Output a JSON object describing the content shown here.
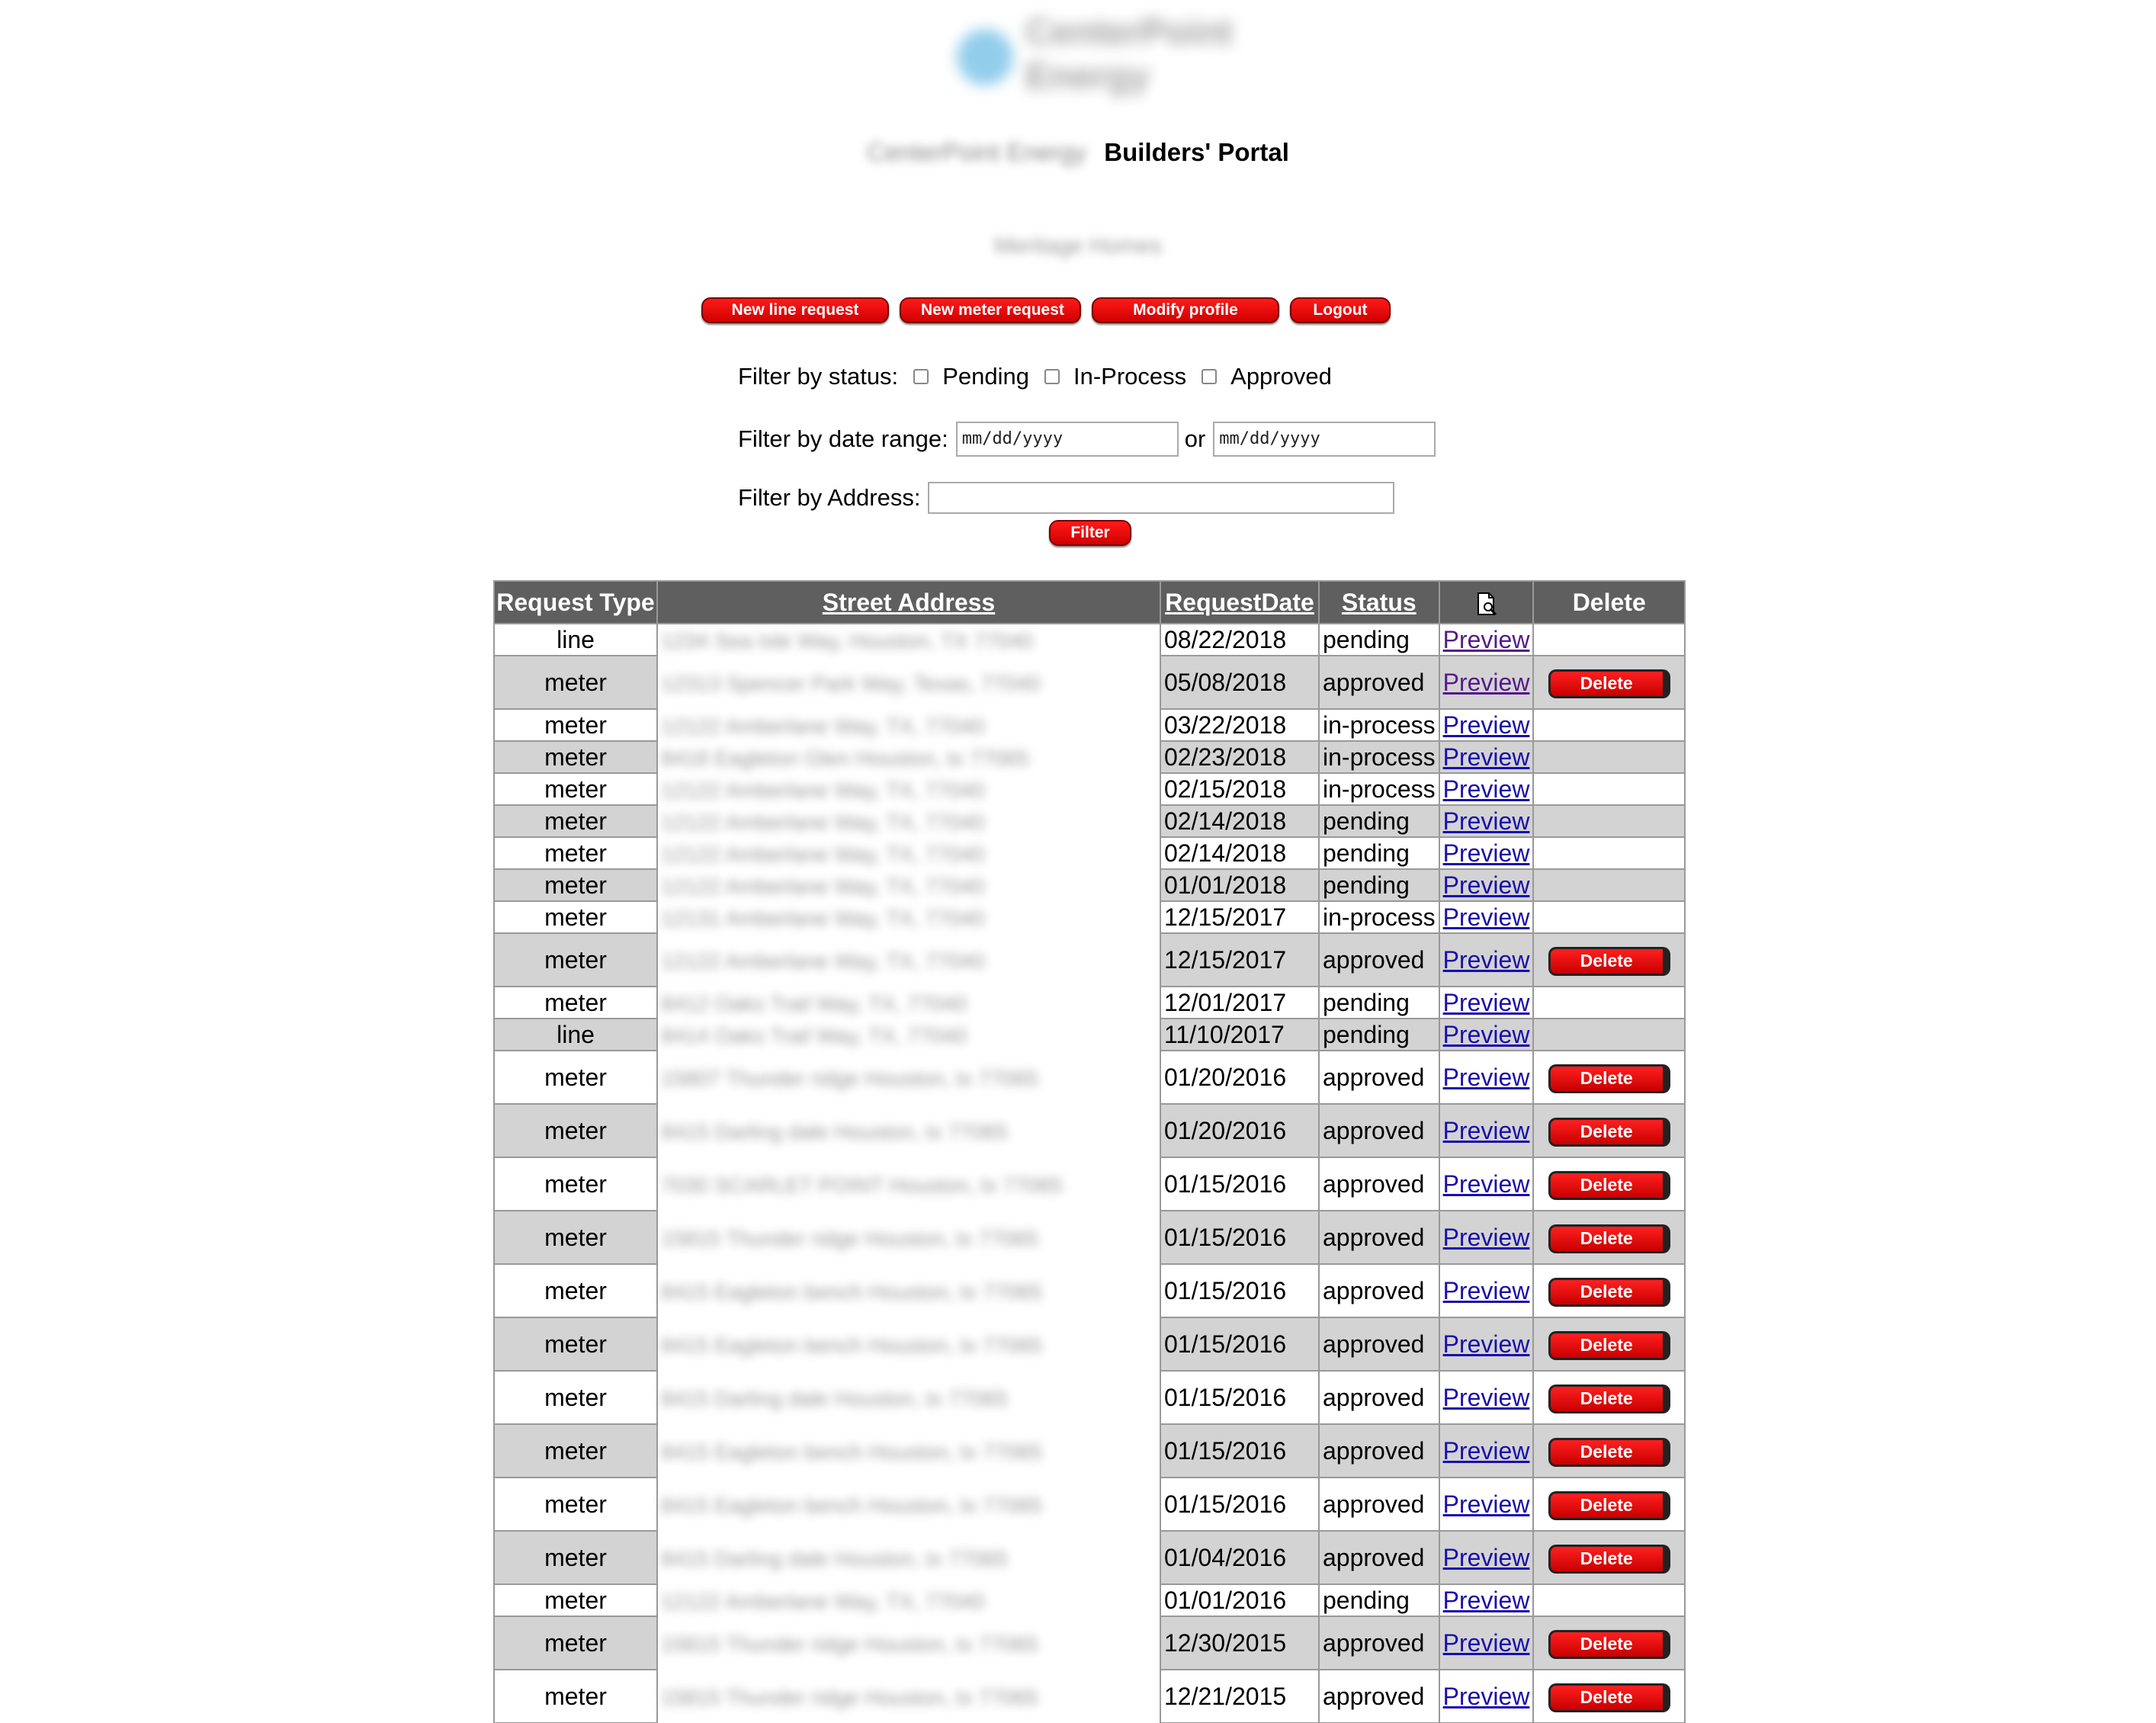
{
  "header": {
    "logo_text": "CenterPoint\nEnergy",
    "company": "CenterPoint Energy",
    "portal_title": "Builders' Portal",
    "builder_name": "Meritage Homes"
  },
  "toolbar": {
    "new_line_label": "New line request",
    "new_meter_label": "New meter request",
    "modify_profile_label": "Modify profile",
    "logout_label": "Logout"
  },
  "filters": {
    "status_label": "Filter by status:",
    "pending_label": "Pending",
    "inprocess_label": "In-Process",
    "approved_label": "Approved",
    "date_label": "Filter by date range:",
    "date_from_placeholder": "mm/dd/yyyy",
    "or_label": "or",
    "date_to_placeholder": "mm/dd/yyyy",
    "address_label": "Filter by Address:",
    "filter_button_label": "Filter"
  },
  "table": {
    "headers": {
      "type": "Request Type",
      "address": "Street Address",
      "date": "RequestDate",
      "status": "Status",
      "preview_icon": "document-preview-icon",
      "delete": "Delete"
    },
    "preview_label": "Preview",
    "delete_label": "Delete",
    "rows": [
      {
        "type": "line",
        "address": "1234 Sea Isle Way, Houston, TX 77040",
        "date": "08/22/2018",
        "status": "pending",
        "delete": false
      },
      {
        "type": "meter",
        "address": "12313 Spencer Park Way, Texas, 77040",
        "date": "05/08/2018",
        "status": "approved",
        "delete": true
      },
      {
        "type": "meter",
        "address": "12122 Amberlane Way, TX, 77040",
        "date": "03/22/2018",
        "status": "in-process",
        "delete": false
      },
      {
        "type": "meter",
        "address": "8418 Eagleton Glen Houston, tx 77065",
        "date": "02/23/2018",
        "status": "in-process",
        "delete": false
      },
      {
        "type": "meter",
        "address": "12122 Amberlane Way, TX, 77040",
        "date": "02/15/2018",
        "status": "in-process",
        "delete": false
      },
      {
        "type": "meter",
        "address": "12122 Amberlane Way, TX, 77040",
        "date": "02/14/2018",
        "status": "pending",
        "delete": false
      },
      {
        "type": "meter",
        "address": "12122 Amberlane Way, TX, 77040",
        "date": "02/14/2018",
        "status": "pending",
        "delete": false
      },
      {
        "type": "meter",
        "address": "12122 Amberlane Way, TX, 77040",
        "date": "01/01/2018",
        "status": "pending",
        "delete": false
      },
      {
        "type": "meter",
        "address": "12131 Amberlane Way, TX, 77040",
        "date": "12/15/2017",
        "status": "in-process",
        "delete": false
      },
      {
        "type": "meter",
        "address": "12122 Amberlane Way, TX, 77040",
        "date": "12/15/2017",
        "status": "approved",
        "delete": true
      },
      {
        "type": "meter",
        "address": "8412 Oaks Trail Way, TX, 77040",
        "date": "12/01/2017",
        "status": "pending",
        "delete": false
      },
      {
        "type": "line",
        "address": "8414 Oaks Trail Way, TX, 77040",
        "date": "11/10/2017",
        "status": "pending",
        "delete": false
      },
      {
        "type": "meter",
        "address": "15807 Thunder ridge Houston, tx 77065",
        "date": "01/20/2016",
        "status": "approved",
        "delete": true
      },
      {
        "type": "meter",
        "address": "8415 Darling dale Houston, tx 77065",
        "date": "01/20/2016",
        "status": "approved",
        "delete": true
      },
      {
        "type": "meter",
        "address": "7030 SCARLET POINT Houston, tx 77065",
        "date": "01/15/2016",
        "status": "approved",
        "delete": true
      },
      {
        "type": "meter",
        "address": "15815 Thunder ridge Houston, tx 77065",
        "date": "01/15/2016",
        "status": "approved",
        "delete": true
      },
      {
        "type": "meter",
        "address": "8415 Eagleton bench Houston, tx 77065",
        "date": "01/15/2016",
        "status": "approved",
        "delete": true
      },
      {
        "type": "meter",
        "address": "8415 Eagleton bench Houston, tx 77065",
        "date": "01/15/2016",
        "status": "approved",
        "delete": true
      },
      {
        "type": "meter",
        "address": "8415 Darling dale Houston, tx 77065",
        "date": "01/15/2016",
        "status": "approved",
        "delete": true
      },
      {
        "type": "meter",
        "address": "8415 Eagleton bench Houston, tx 77065",
        "date": "01/15/2016",
        "status": "approved",
        "delete": true
      },
      {
        "type": "meter",
        "address": "8415 Eagleton bench Houston, tx 77065",
        "date": "01/15/2016",
        "status": "approved",
        "delete": true
      },
      {
        "type": "meter",
        "address": "8415 Darling dale Houston, tx 77065",
        "date": "01/04/2016",
        "status": "approved",
        "delete": true
      },
      {
        "type": "meter",
        "address": "12122 Amberlane Way, TX, 77040",
        "date": "01/01/2016",
        "status": "pending",
        "delete": false
      },
      {
        "type": "meter",
        "address": "15815 Thunder ridge Houston, tx 77065",
        "date": "12/30/2015",
        "status": "approved",
        "delete": true
      },
      {
        "type": "meter",
        "address": "15815 Thunder ridge Houston, tx 77065",
        "date": "12/21/2015",
        "status": "approved",
        "delete": true
      }
    ]
  }
}
